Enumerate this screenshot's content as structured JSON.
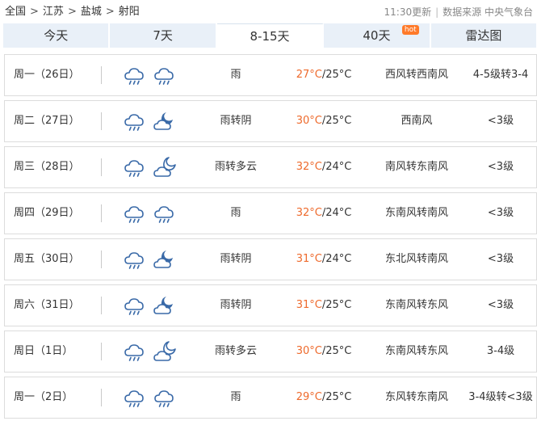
{
  "breadcrumb": {
    "items": [
      "全国",
      "江苏",
      "盐城",
      "射阳"
    ],
    "separator": ">"
  },
  "meta": {
    "update_time": "11:30更新",
    "source": "数据来源 中央气象台"
  },
  "tabs": [
    {
      "label": "今天",
      "active": false
    },
    {
      "label": "7天",
      "active": false
    },
    {
      "label": "8-15天",
      "active": true
    },
    {
      "label": "40天",
      "active": false,
      "badge": "hot"
    },
    {
      "label": "雷达图",
      "active": false
    }
  ],
  "colors": {
    "high_temp": "#ee6a2c",
    "icon_stroke": "#3a6aa8",
    "tab_bg": "#e9f0f8"
  },
  "forecast": [
    {
      "date": "周一（26日）",
      "icons": [
        "rain-cloud-icon",
        "rain-cloud-icon"
      ],
      "desc": "雨",
      "high": "27°C",
      "low": "/25°C",
      "wind": "西风转西南风",
      "level": "4-5级转3-4"
    },
    {
      "date": "周二（27日）",
      "icons": [
        "rain-cloud-icon",
        "moon-cloud-icon"
      ],
      "desc": "雨转阴",
      "high": "30°C",
      "low": "/25°C",
      "wind": "西南风",
      "level": "<3级"
    },
    {
      "date": "周三（28日）",
      "icons": [
        "rain-cloud-icon",
        "moon-partly-cloudy-icon"
      ],
      "desc": "雨转多云",
      "high": "32°C",
      "low": "/24°C",
      "wind": "南风转东南风",
      "level": "<3级"
    },
    {
      "date": "周四（29日）",
      "icons": [
        "rain-cloud-icon",
        "rain-cloud-icon"
      ],
      "desc": "雨",
      "high": "32°C",
      "low": "/24°C",
      "wind": "东南风转南风",
      "level": "<3级"
    },
    {
      "date": "周五（30日）",
      "icons": [
        "rain-cloud-icon",
        "moon-cloud-icon"
      ],
      "desc": "雨转阴",
      "high": "31°C",
      "low": "/24°C",
      "wind": "东北风转南风",
      "level": "<3级"
    },
    {
      "date": "周六（31日）",
      "icons": [
        "rain-cloud-icon",
        "moon-cloud-icon"
      ],
      "desc": "雨转阴",
      "high": "31°C",
      "low": "/25°C",
      "wind": "东南风转东风",
      "level": "<3级"
    },
    {
      "date": "周日（1日）",
      "icons": [
        "rain-cloud-icon",
        "moon-partly-cloudy-icon"
      ],
      "desc": "雨转多云",
      "high": "30°C",
      "low": "/25°C",
      "wind": "东南风转东风",
      "level": "3-4级"
    },
    {
      "date": "周一（2日）",
      "icons": [
        "rain-cloud-icon",
        "rain-cloud-icon"
      ],
      "desc": "雨",
      "high": "29°C",
      "low": "/25°C",
      "wind": "东风转东南风",
      "level": "3-4级转<3级"
    }
  ]
}
